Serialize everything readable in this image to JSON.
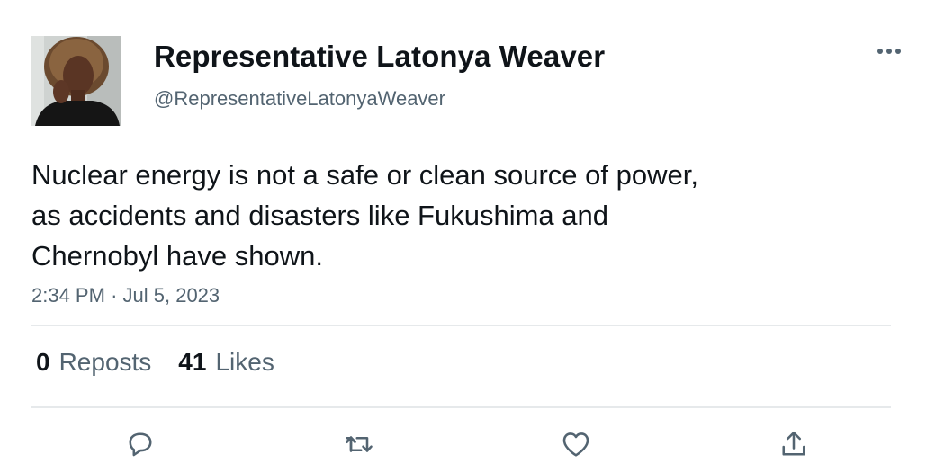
{
  "author": {
    "name": "Representative Latonya Weaver",
    "handle": "@RepresentativeLatonyaWeaver"
  },
  "post": {
    "lines": [
      "Nuclear energy is not a safe or clean source of power,",
      "as accidents and disasters like Fukushima and",
      "Chernobyl have shown."
    ],
    "time": "2:34 PM",
    "separator": "·",
    "date": "Jul 5, 2023"
  },
  "stats": {
    "reposts_count": "0",
    "reposts_label": "Reposts",
    "likes_count": "41",
    "likes_label": "Likes"
  },
  "actions": [
    "reply-icon",
    "repost-icon",
    "like-icon",
    "share-icon"
  ],
  "colors": {
    "text": "#0f1419",
    "secondary": "#536471",
    "divider": "#e6e9eb"
  }
}
